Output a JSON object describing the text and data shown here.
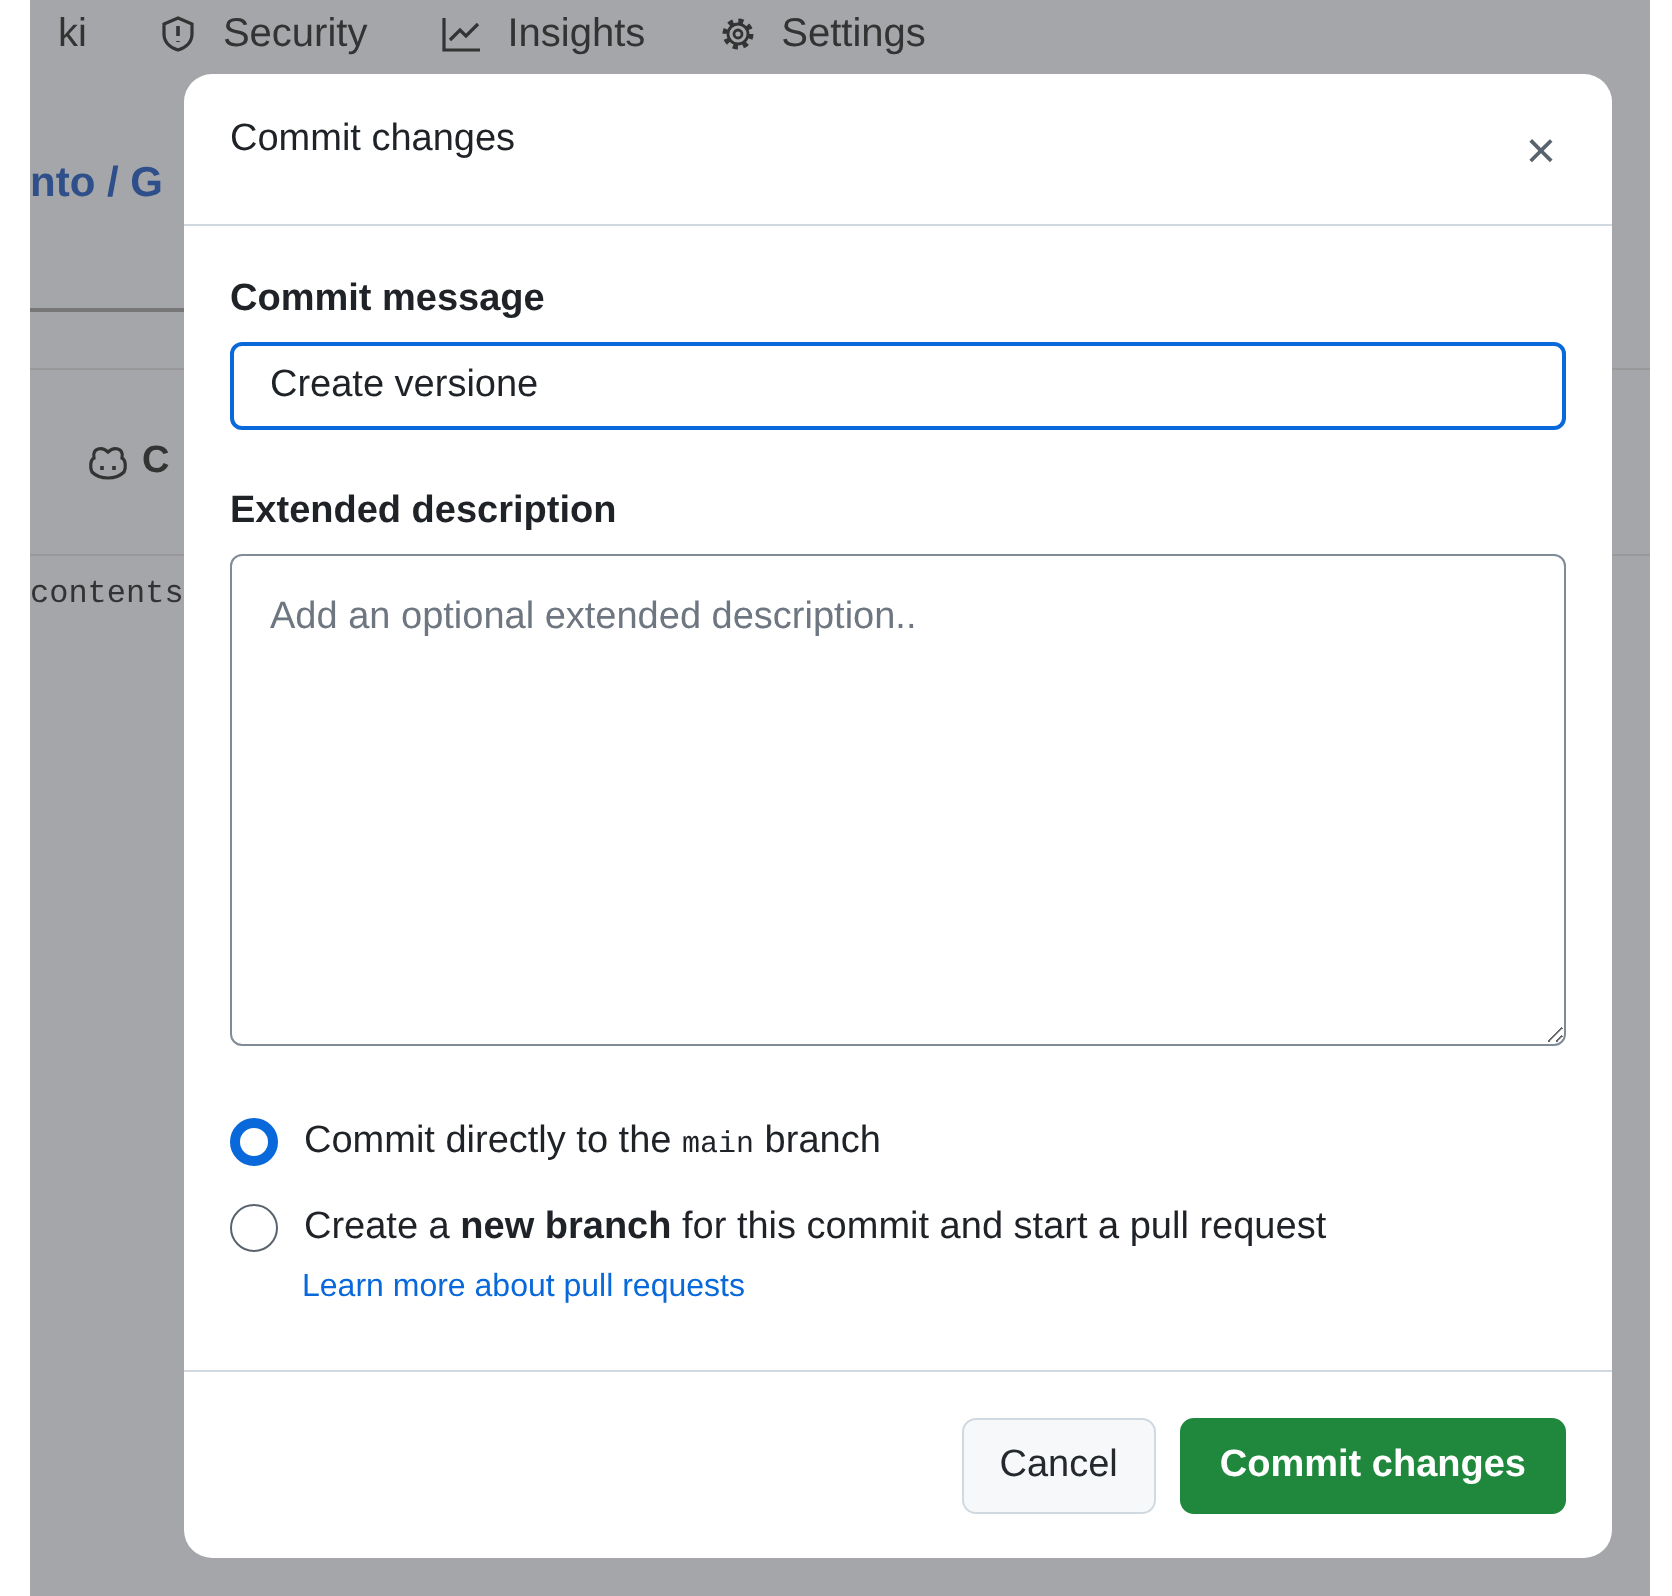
{
  "background_page": {
    "tabs": [
      {
        "label": "ki"
      },
      {
        "label": "Security"
      },
      {
        "label": "Insights"
      },
      {
        "label": "Settings"
      }
    ],
    "breadcrumb": "nto / G",
    "button_label": "C",
    "file_text": "contents"
  },
  "dialog": {
    "title": "Commit changes",
    "close": "×",
    "message_label": "Commit message",
    "message_value": "Create versione",
    "description_label": "Extended description",
    "description_placeholder": "Add an optional extended description..",
    "options": [
      {
        "selected": true,
        "text_before": "Commit directly to the ",
        "code": "main",
        "text_after": " branch"
      },
      {
        "selected": false,
        "text": "Create a **new branch** for this commit and start a pull request"
      }
    ],
    "link": "Learn more about pull requests",
    "buttons": [
      {
        "label": "Cancel",
        "kind": "secondary"
      },
      {
        "label": "Commit changes",
        "kind": "primary"
      }
    ]
  }
}
